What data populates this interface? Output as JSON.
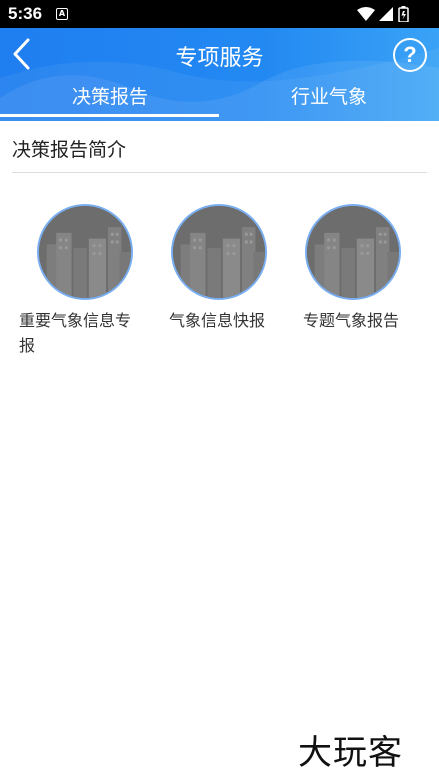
{
  "status_bar": {
    "time": "5:36",
    "notification_icon": "a-notification-icon",
    "indicators": [
      "wifi-icon",
      "signal-icon",
      "battery-icon"
    ]
  },
  "header": {
    "title": "专项服务",
    "back_icon": "chevron-left-icon",
    "help_label": "?",
    "help_icon": "help-circle-icon"
  },
  "tabs": [
    {
      "label": "决策报告",
      "active": true
    },
    {
      "label": "行业气象",
      "active": false
    }
  ],
  "section": {
    "title": "决策报告简介"
  },
  "services": [
    {
      "label": "重要气象信息专报",
      "icon": "city-skyline-icon"
    },
    {
      "label": "气象信息快报",
      "icon": "city-skyline-icon"
    },
    {
      "label": "专题气象报告",
      "icon": "city-skyline-icon"
    }
  ],
  "watermark": {
    "text": "大玩客"
  },
  "colors": {
    "header_blue": "#2389f2",
    "icon_gray": "#6f6f6f",
    "icon_ring": "#79aef0"
  }
}
